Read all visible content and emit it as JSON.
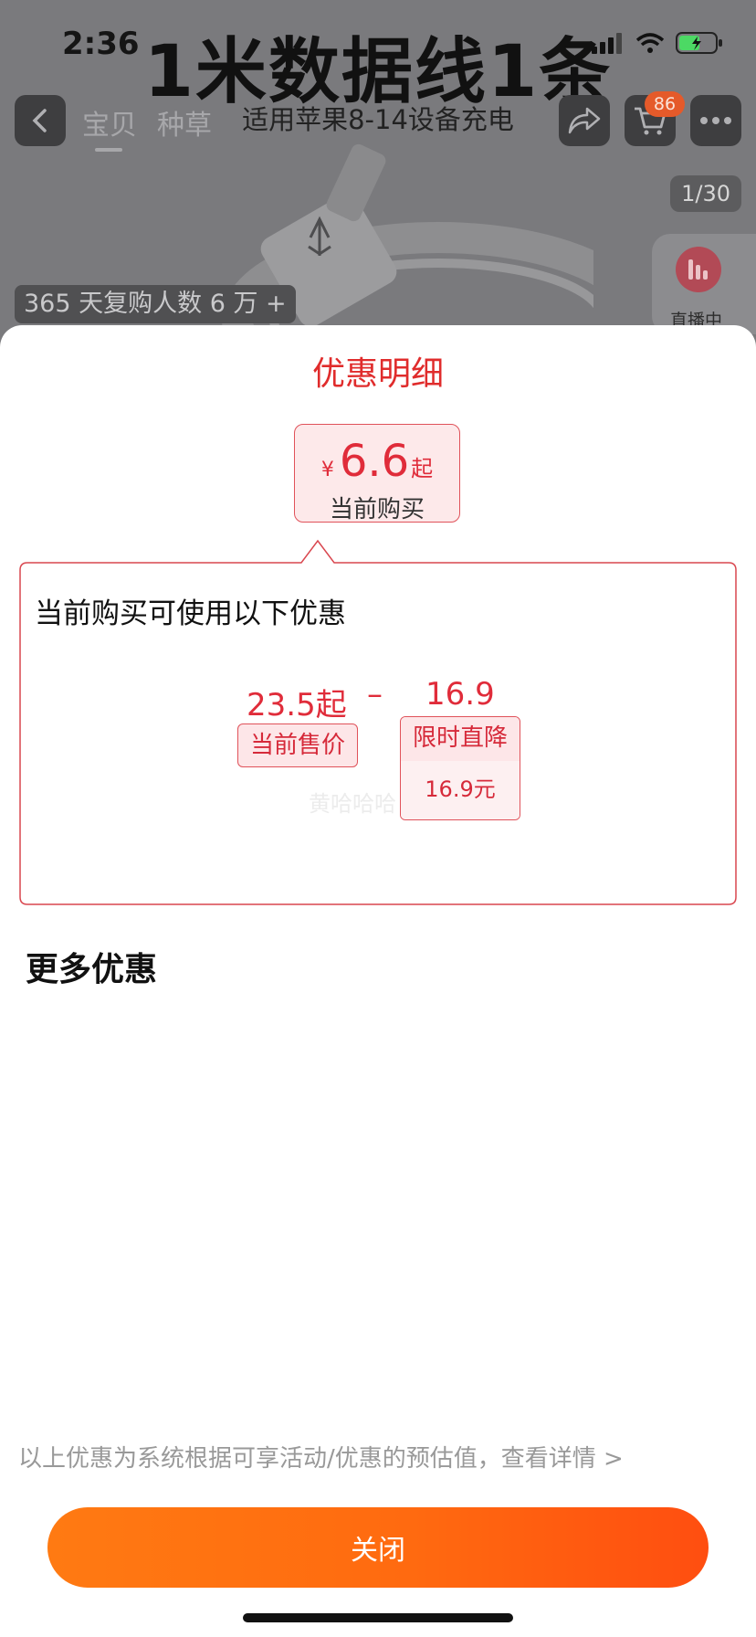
{
  "status_bar": {
    "time": "2:36"
  },
  "banner": {
    "title": "1米数据线1条",
    "subtitle": "适用苹果8-14设备充电"
  },
  "nav": {
    "tabs": [
      {
        "label": "宝贝",
        "active": true
      },
      {
        "label": "种草",
        "active": false
      }
    ],
    "cart_count": "86"
  },
  "gallery": {
    "page_counter": "1/30",
    "repurchase_badge": "365 天复购人数 6 万 +"
  },
  "live": {
    "label": "直播中"
  },
  "sheet": {
    "title": "优惠明细",
    "price": {
      "currency": "¥",
      "amount": "6.6",
      "suffix": "起",
      "caption": "当前购买"
    },
    "discount": {
      "heading": "当前购买可使用以下优惠",
      "current_price": "23.5起",
      "operator": "–",
      "deduction": "16.9",
      "current_price_label": "当前售价",
      "limited_label": "限时直降",
      "limited_value": "16.9元",
      "watermark": "黄哈哈哈"
    },
    "more_title": "更多优惠",
    "footnote": "以上优惠为系统根据可享活动/优惠的预估值，查看详情 >",
    "close_label": "关闭"
  },
  "colors": {
    "accent_red": "#e02c3a",
    "button_orange": "#ff6a10",
    "overlay_gray": "#7a7a7d"
  }
}
